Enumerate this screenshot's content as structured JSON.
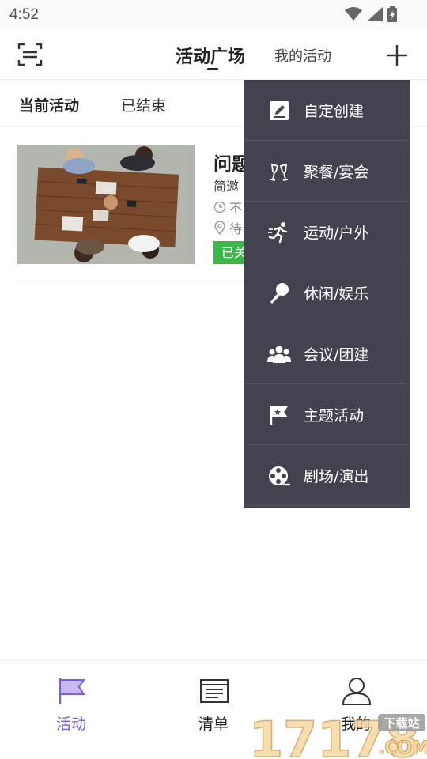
{
  "status_bar": {
    "time": "4:52"
  },
  "header": {
    "tab_plaza": "活动广场",
    "tab_mine": "我的活动"
  },
  "subtabs": {
    "current": "当前活动",
    "ended": "已结束"
  },
  "activity_card": {
    "title": "问题反馈",
    "desc": "简邀",
    "time": "不",
    "location": "待",
    "badge": "已关"
  },
  "menu": {
    "items": [
      {
        "label": "自定创建",
        "icon": "edit-icon"
      },
      {
        "label": "聚餐/宴会",
        "icon": "cheers-icon"
      },
      {
        "label": "运动/户外",
        "icon": "running-icon"
      },
      {
        "label": "休闲/娱乐",
        "icon": "microphone-icon"
      },
      {
        "label": "会议/团建",
        "icon": "group-icon"
      },
      {
        "label": "主题活动",
        "icon": "flag-icon"
      },
      {
        "label": "剧场/演出",
        "icon": "film-reel-icon"
      }
    ]
  },
  "bottom_nav": {
    "items": [
      {
        "label": "活动",
        "icon": "flag-icon",
        "active": true
      },
      {
        "label": "清单",
        "icon": "list-icon",
        "active": false
      },
      {
        "label": "我的",
        "icon": "user-icon",
        "active": false
      }
    ]
  },
  "watermark": {
    "text": "17178",
    "badge": "下载站",
    "suffix": ".COM"
  },
  "colors": {
    "accent": "#7b5fd6",
    "menu_bg": "#45424f",
    "badge_green": "#3cb84a"
  }
}
